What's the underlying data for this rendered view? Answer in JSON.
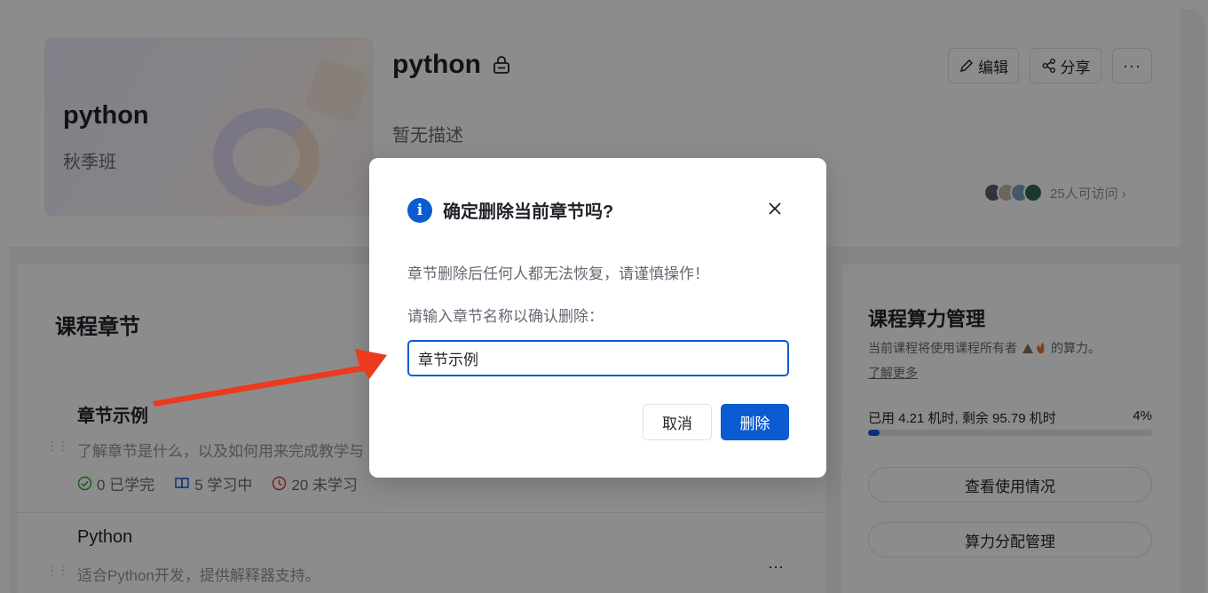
{
  "course": {
    "cover_title": "python",
    "cover_subtitle": "秋季班",
    "title": "python",
    "description": "暂无描述",
    "edit_label": "编辑",
    "share_label": "分享",
    "more_label": "···",
    "access_text": "25人可访问 ›"
  },
  "chapters": {
    "section_title": "课程章节",
    "items": [
      {
        "title": "章节示例",
        "description": "了解章节是什么，以及如何用来完成教学与",
        "stats": [
          {
            "icon": "check-circle-icon",
            "text": "0 已学完",
            "color": "#2ea121"
          },
          {
            "icon": "book-icon",
            "text": "5 学习中",
            "color": "#0b5bd3"
          },
          {
            "icon": "clock-icon",
            "text": "20 未学习",
            "color": "#d83931"
          }
        ]
      },
      {
        "title": "Python",
        "description": "适合Python开发，提供解释器支持。",
        "more_label": "···"
      }
    ]
  },
  "compute": {
    "title": "课程算力管理",
    "description": "当前课程将使用课程所有者",
    "description_suffix": "的算力。",
    "learn_more": "了解更多",
    "usage_text": "已用  4.21  机时, 剩余  95.79  机时",
    "usage_percent_label": "4%",
    "usage_fraction": 0.04,
    "view_usage_label": "查看使用情况",
    "allocation_label": "算力分配管理"
  },
  "dialog": {
    "title": "确定删除当前章节吗?",
    "warning": "章节删除后任何人都无法恢复，请谨慎操作！",
    "input_label": "请输入章节名称以确认删除：",
    "input_value": "章节示例",
    "cancel_label": "取消",
    "delete_label": "删除",
    "accent_color": "#0b5bd3"
  }
}
